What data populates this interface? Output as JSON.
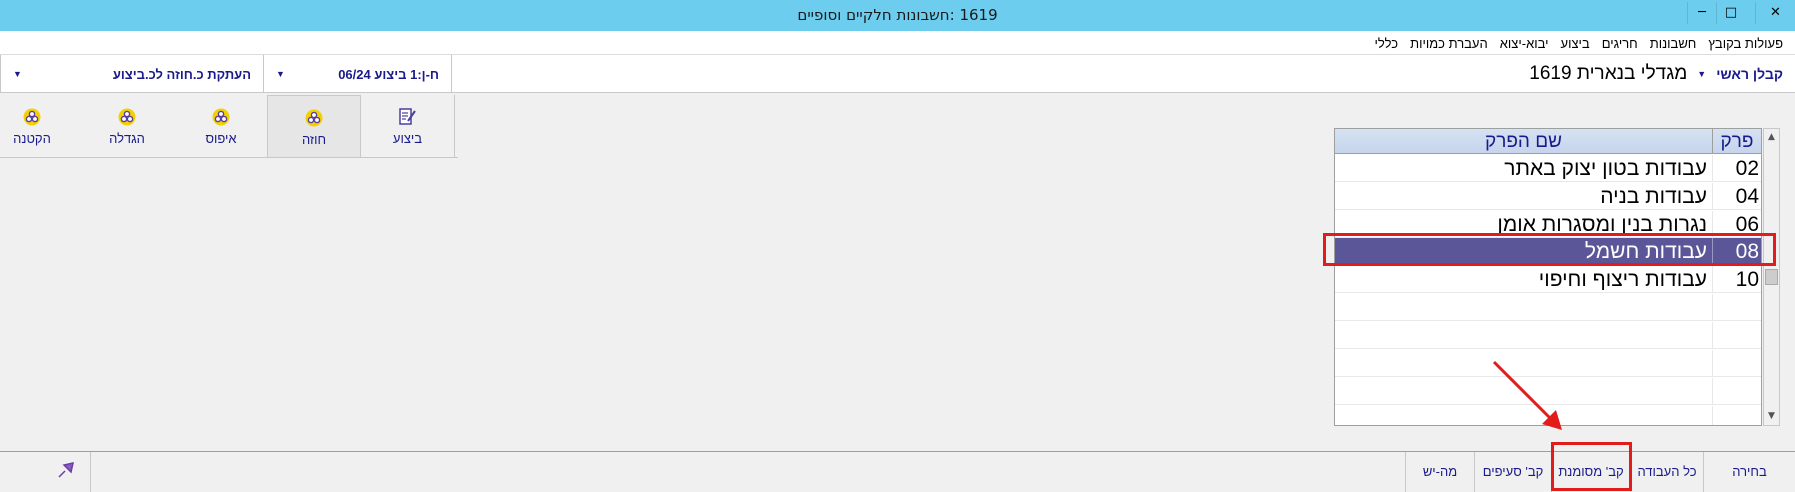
{
  "window": {
    "title": "1619 :חשבונות חלקיים וסופיים",
    "controls": {
      "minimize": "─",
      "maximize": "□",
      "close": "✕"
    }
  },
  "menu": {
    "items": [
      "פעולות בקובץ",
      "חשבונות",
      "חריגים",
      "ביצוע",
      "יבוא-יצוא",
      "העברת כמויות",
      "כללי"
    ]
  },
  "selectors": {
    "contractor_label": "קבלן ראשי",
    "project_name": "מגדלי בנארית 1619",
    "phase_label": "ח-ן:1 ביצוע 06/24",
    "copy_label": "העתקת כ.חוזה לכ.ביצוע",
    "caret": "▼"
  },
  "toolbar": {
    "items": [
      {
        "label": "ביצוע",
        "icon": "edit-document-icon"
      },
      {
        "label": "חוזה",
        "icon": "circles-icon",
        "active": true
      },
      {
        "label": "איפוס",
        "icon": "circles-icon"
      },
      {
        "label": "הגדלה",
        "icon": "circles-icon"
      },
      {
        "label": "הקטנה",
        "icon": "circles-icon"
      }
    ]
  },
  "grid": {
    "headers": {
      "code": "פרק",
      "name": "שם הפרק"
    },
    "rows": [
      {
        "code": "02",
        "name": "עבודות בטון יצוק באתר"
      },
      {
        "code": "04",
        "name": "עבודות בניה"
      },
      {
        "code": "06",
        "name": "נגרות בנין ומסגרות אומן"
      },
      {
        "code": "08",
        "name": "עבודות חשמל",
        "selected": true
      },
      {
        "code": "10",
        "name": "עבודות ריצוף וחיפוי"
      }
    ],
    "empty_rows": 5
  },
  "scrollbar": {
    "up": "▲",
    "down": "▼"
  },
  "bottom_bar": {
    "select": "בחירה",
    "all_work": "כל העבודה",
    "marked": "קב' מסומנת",
    "sections": "קב' סעיפים",
    "mahyesh": "מה-יש"
  },
  "colors": {
    "titlebar": "#6ccdee",
    "accent_text": "#1a1a8c",
    "selected_row": "#5b5697",
    "highlight": "#e21b1b"
  }
}
